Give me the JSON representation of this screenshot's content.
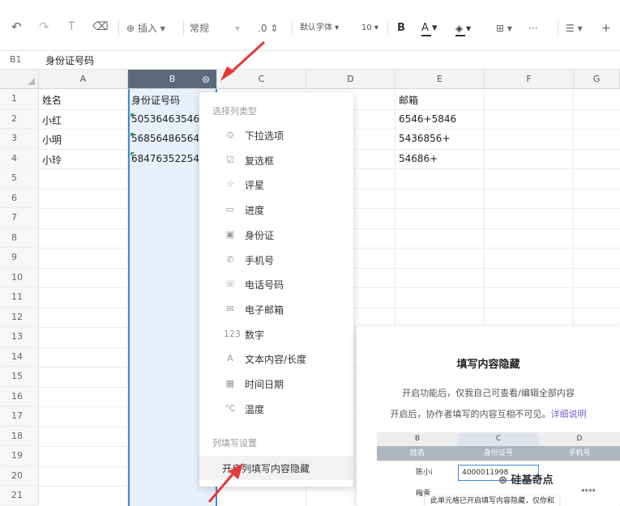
{
  "toolbar": {
    "insert_label": "插入",
    "format_label": "常规",
    "decimal_label": ".0",
    "font_label": "默认字体",
    "fontsize_label": "10",
    "bold_label": "B",
    "fontcolor_label": "A",
    "fill_label": "◈",
    "border_label": "⊞",
    "more_label": "···",
    "align_label": "☰",
    "extra_label": "+",
    "undo_icon": "undo-icon",
    "redo_icon": "redo-icon",
    "format_painter_icon": "format-painter-icon",
    "eraser_icon": "eraser-icon"
  },
  "formula_bar": {
    "cell_ref": "B1",
    "value": "身份证号码"
  },
  "grid": {
    "columns": [
      "A",
      "B",
      "C",
      "D",
      "E",
      "F",
      "G"
    ],
    "rows": [
      "1",
      "2",
      "3",
      "4",
      "5",
      "6",
      "7",
      "8",
      "9",
      "10",
      "11",
      "12",
      "13",
      "14",
      "15",
      "16",
      "17",
      "18",
      "19",
      "20",
      "21"
    ],
    "cells": {
      "A1": "姓名",
      "A2": "小红",
      "A3": "小明",
      "A4": "小玲",
      "B1": "身份证号码",
      "B2": "50536463546",
      "B3": "56856486564",
      "B4": "68476352254",
      "E1": "邮箱",
      "E2": "6546+5846",
      "E3": "5436856+",
      "E4": "54686+"
    }
  },
  "column_menu": {
    "heading": "选择列类型",
    "items": [
      {
        "icon": "⊙",
        "label": "下拉选项"
      },
      {
        "icon": "☑",
        "label": "复选框"
      },
      {
        "icon": "☆",
        "label": "评星"
      },
      {
        "icon": "▭",
        "label": "进度"
      },
      {
        "icon": "▣",
        "label": "身份证"
      },
      {
        "icon": "✆",
        "label": "手机号"
      },
      {
        "icon": "☏",
        "label": "电话号码"
      },
      {
        "icon": "✉",
        "label": "电子邮箱"
      },
      {
        "icon": "123",
        "label": "数字"
      },
      {
        "icon": "A",
        "label": "文本内容/长度"
      },
      {
        "icon": "▦",
        "label": "时间日期"
      },
      {
        "icon": "°C",
        "label": "温度"
      }
    ],
    "section2_heading": "列填写设置",
    "hide_option": "开启列填写内容隐藏"
  },
  "popup": {
    "title": "填写内容隐藏",
    "line1": "开启功能后，仅我自己可查看/编辑全部内容",
    "line2": "开启后，协作者填写的内容互相不可见。",
    "link": "详细说明",
    "mini_cols": [
      "B",
      "C",
      "D"
    ],
    "mini_headers": [
      "姓名",
      "身份证号",
      "手机号"
    ],
    "mini_row_name": "陈小i",
    "mini_input": "4000011998",
    "mini_row2_name": "梅雪",
    "mini_hidden": "****",
    "mini_footer": "此单元格已开启填写内容隐藏，仅你和"
  },
  "watermark": "硅基奇点",
  "colors": {
    "accent": "#3d88d8",
    "arrow": "#e53935",
    "link": "#7b5fd1"
  }
}
